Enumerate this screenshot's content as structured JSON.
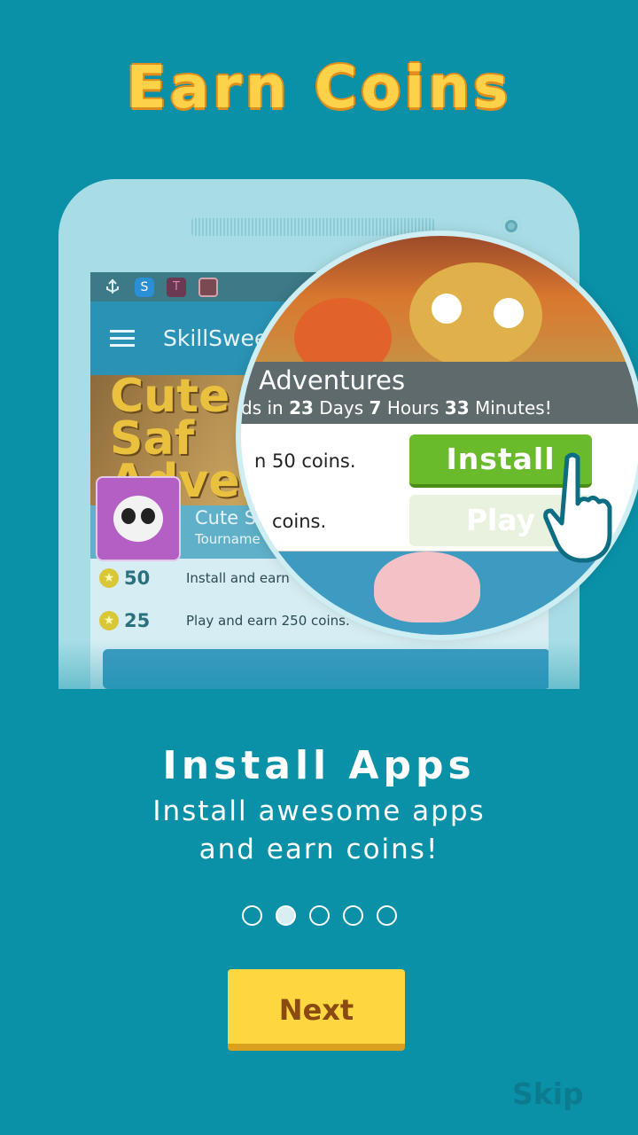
{
  "header": {
    "title": "Earn Coins"
  },
  "phone": {
    "status_icons": [
      "usb-icon",
      "skype-icon",
      "tmobile-icon",
      "gift-icon"
    ],
    "app_title": "SkillSwee",
    "banner_text": "Cute Saf Adven",
    "card": {
      "title": "Cute S",
      "subtitle": "Tourname"
    },
    "rows": [
      {
        "coins": "50",
        "desc": "Install and earn"
      },
      {
        "coins": "25",
        "desc": "Play and earn 250 coins."
      }
    ]
  },
  "magnifier": {
    "title": "Adventures",
    "ends_prefix": "ds in ",
    "days": "23",
    "days_label": " Days ",
    "hours": "7",
    "hours_label": " Hours ",
    "minutes": "33",
    "minutes_label": " Minutes!",
    "row1_text": "n 50 coins.",
    "row2_text": "coins.",
    "install_label": "Install",
    "play_label": "Play"
  },
  "onboarding": {
    "step_title": "Install Apps",
    "step_desc_line1": "Install awesome apps",
    "step_desc_line2": "and earn coins!",
    "active_page": 2,
    "total_pages": 5
  },
  "buttons": {
    "next_label": "Next",
    "skip_label": "Skip"
  },
  "colors": {
    "background": "#0a91a8",
    "accent_yellow": "#fdd73f",
    "install_green": "#6abb2b"
  }
}
